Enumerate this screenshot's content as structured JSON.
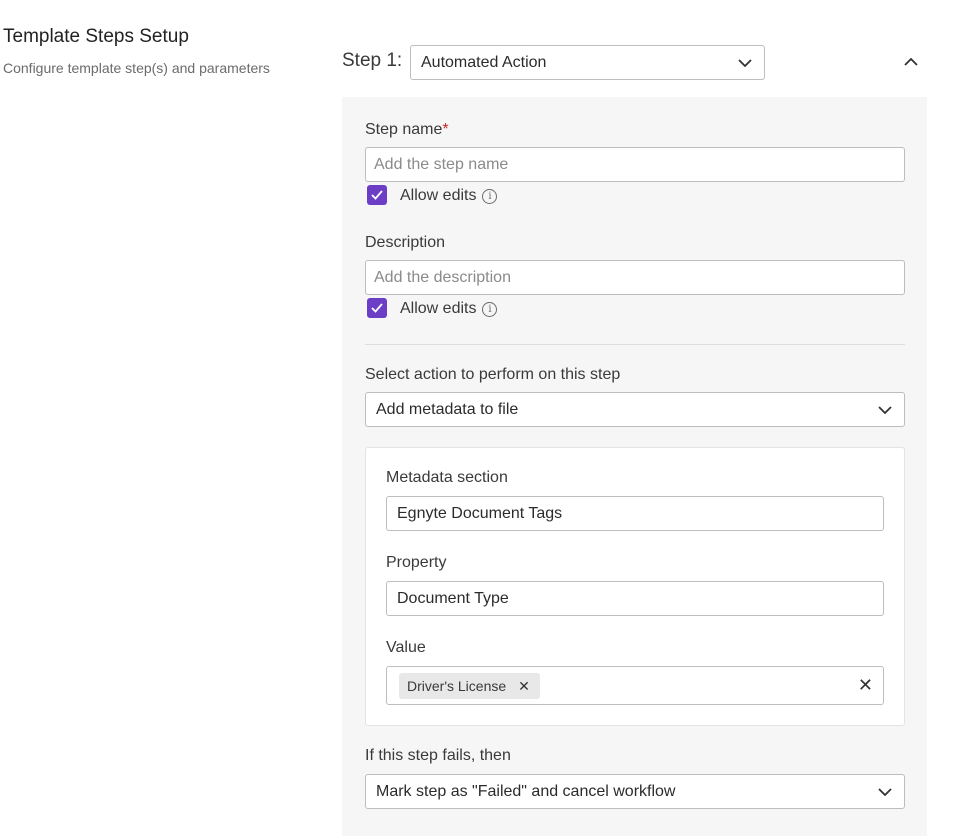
{
  "sidebar": {
    "title": "Template Steps Setup",
    "subtitle": "Configure template step(s) and parameters"
  },
  "step": {
    "label": "Step 1:",
    "type_value": "Automated Action"
  },
  "form": {
    "step_name_label": "Step name",
    "required_mark": "*",
    "step_name_placeholder": "Add the step name",
    "allow_edits_label": "Allow edits",
    "allow_edits_info_icon": "info-icon",
    "description_label": "Description",
    "description_placeholder": "Add the description",
    "description_allow_edits_label": "Allow edits",
    "action_label": "Select action to perform on this step",
    "action_value": "Add metadata to file",
    "metadata_section_label": "Metadata section",
    "metadata_section_value": "Egnyte Document Tags",
    "property_label": "Property",
    "property_value": "Document Type",
    "value_label": "Value",
    "value_tags": [
      "Driver's License"
    ],
    "fail_label": "If this step fails, then",
    "fail_value": "Mark step as \"Failed\" and cancel workflow"
  },
  "colors": {
    "checkbox": "#6c3ec6",
    "required": "#c62828",
    "panel_bg": "#f6f6f6"
  }
}
